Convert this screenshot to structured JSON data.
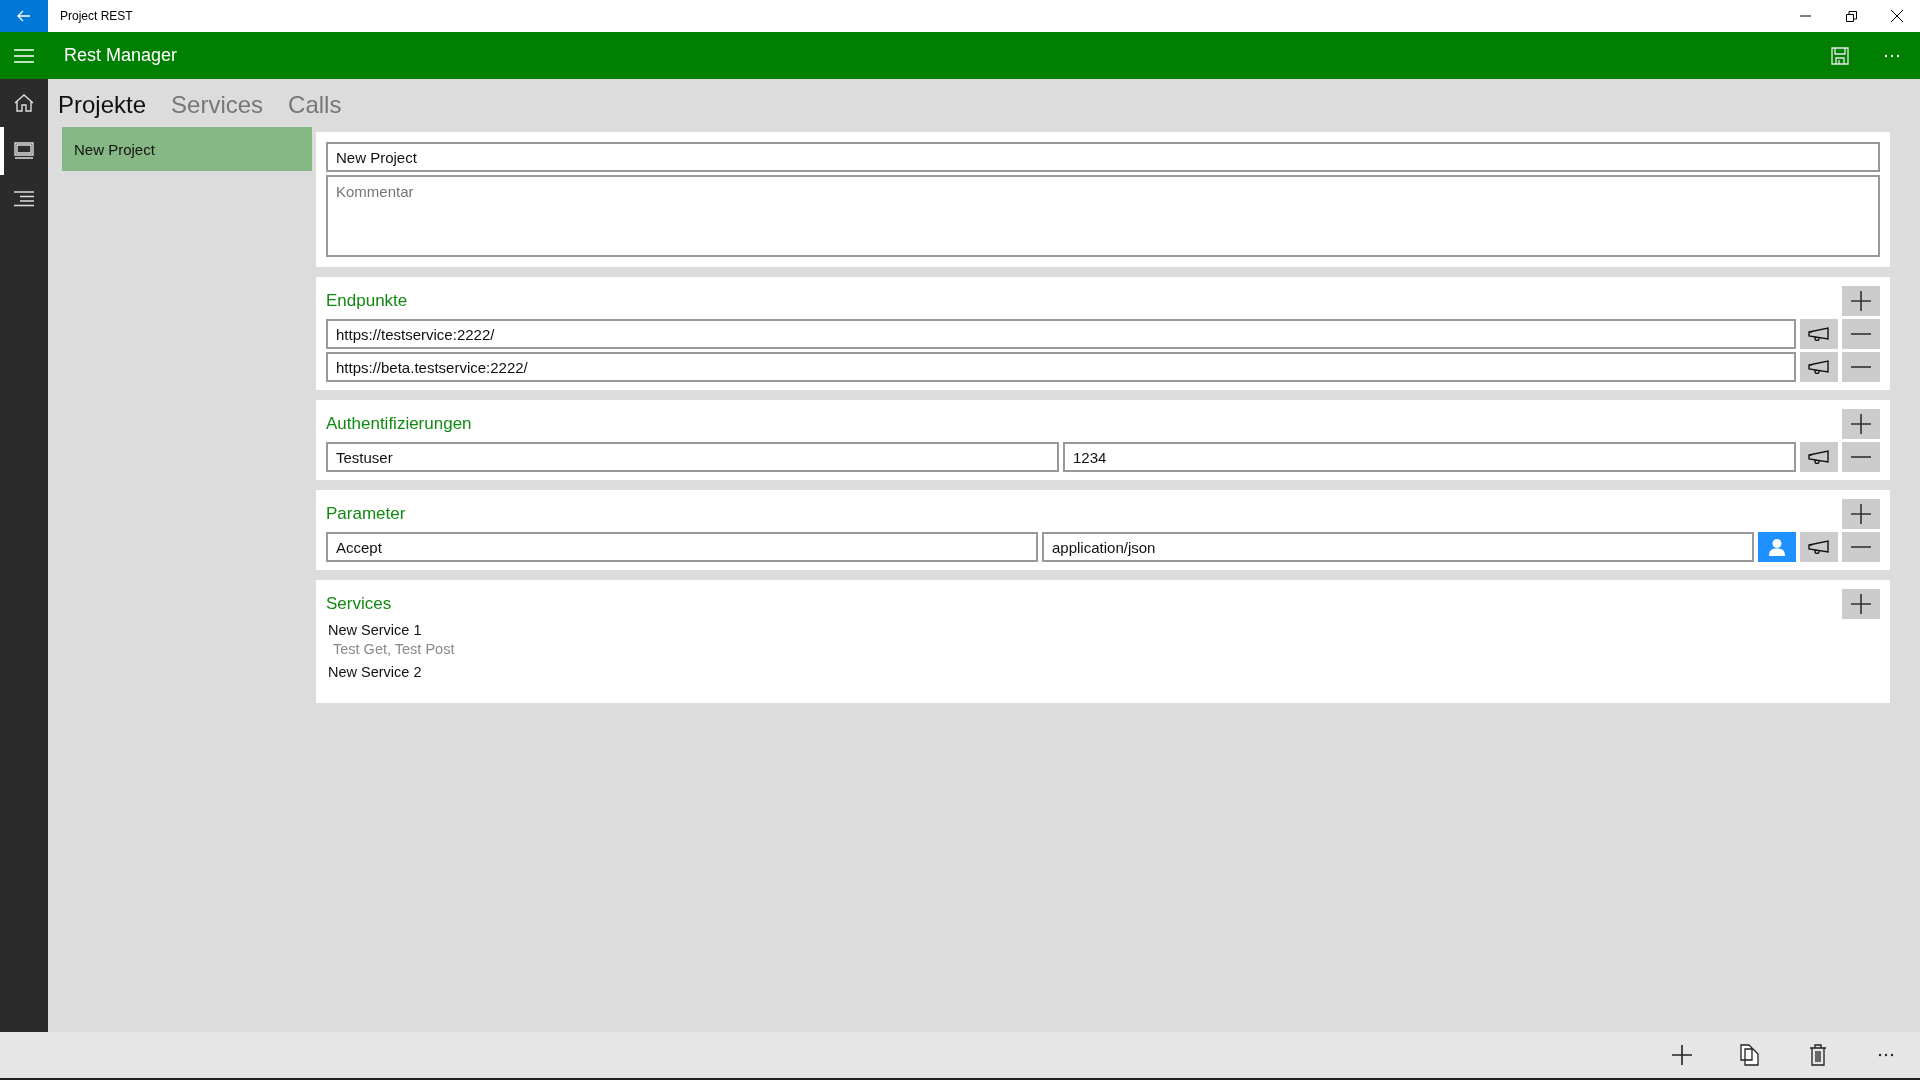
{
  "window": {
    "title": "Project REST"
  },
  "header": {
    "title": "Rest Manager"
  },
  "nav": [
    {
      "kind": "home",
      "selected": false
    },
    {
      "kind": "monitor",
      "selected": true
    },
    {
      "kind": "list",
      "selected": false
    }
  ],
  "tabs": [
    {
      "label": "Projekte",
      "selected": true
    },
    {
      "label": "Services",
      "selected": false
    },
    {
      "label": "Calls",
      "selected": false
    }
  ],
  "projects": [
    {
      "name": "New Project",
      "selected": true
    }
  ],
  "project": {
    "name": "New Project",
    "comment_placeholder": "Kommentar"
  },
  "endpoints": {
    "title": "Endpunkte",
    "rows": [
      {
        "url": "https://testservice:2222/"
      },
      {
        "url": "https://beta.testservice:2222/"
      }
    ]
  },
  "authentications": {
    "title": "Authentifizierungen",
    "rows": [
      {
        "user": "Testuser",
        "password": "1234"
      }
    ]
  },
  "parameters": {
    "title": "Parameter",
    "rows": [
      {
        "name": "Accept",
        "value": "application/json",
        "user_on": true
      }
    ]
  },
  "services": {
    "title": "Services",
    "items": [
      {
        "name": "New Service 1",
        "calls": "Test Get, Test Post"
      },
      {
        "name": "New Service 2"
      }
    ]
  }
}
